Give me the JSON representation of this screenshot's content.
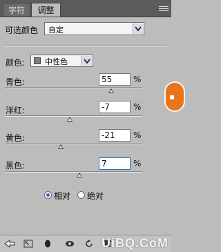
{
  "tabs": [
    {
      "label": "字符"
    },
    {
      "label": "调整"
    }
  ],
  "preset": {
    "label": "可选颜色",
    "value": "自定"
  },
  "colors_select": {
    "label": "颜色:",
    "value": "中性色",
    "swatch": "#808080"
  },
  "sliders": [
    {
      "label": "青色:",
      "value": "55",
      "unit": "%",
      "level": 55
    },
    {
      "label": "洋红:",
      "value": "-7",
      "unit": "%",
      "level": -7
    },
    {
      "label": "黄色:",
      "value": "-21",
      "unit": "%",
      "level": -21
    },
    {
      "label": "黑色:",
      "value": "7",
      "unit": "%",
      "level": 7
    }
  ],
  "method": {
    "options": [
      {
        "label": "相对",
        "selected": true
      },
      {
        "label": "绝对",
        "selected": false
      }
    ]
  },
  "watermark": "UiBQ.CoM",
  "icons": {
    "menu": "panel-menu-icon",
    "back": "back-arrow-icon",
    "expand": "expand-icon",
    "mask": "layer-mask-icon",
    "eye": "visibility-icon",
    "reset": "reset-icon",
    "trash": "trash-icon"
  }
}
